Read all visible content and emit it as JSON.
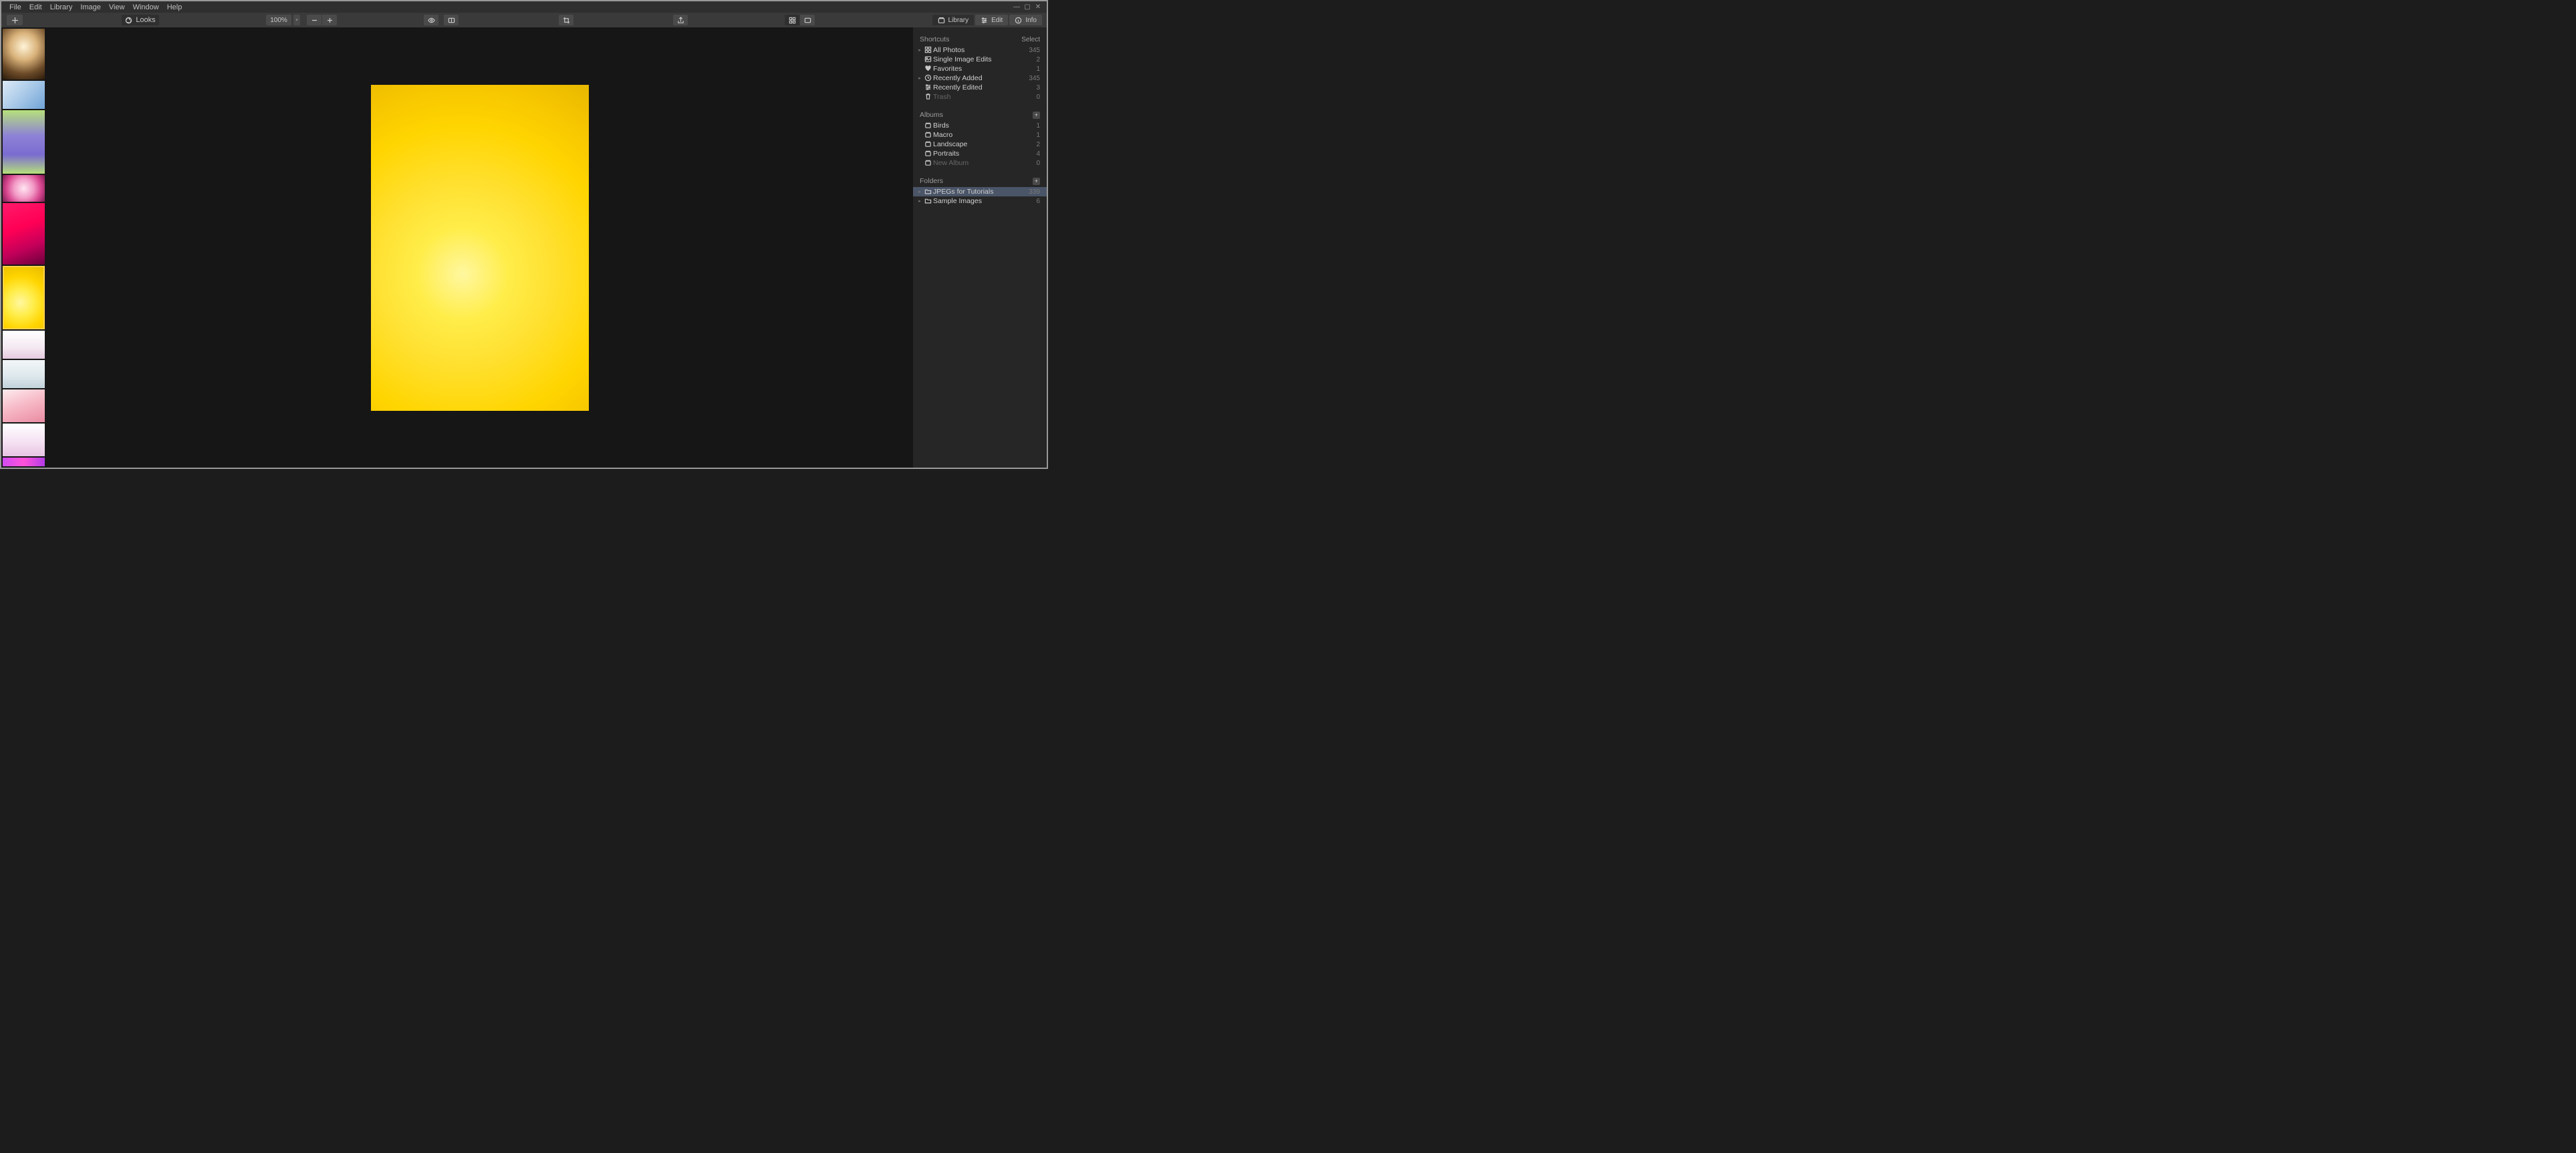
{
  "menu": {
    "items": [
      "File",
      "Edit",
      "Library",
      "Image",
      "View",
      "Window",
      "Help"
    ]
  },
  "toolbar": {
    "looks_label": "Looks",
    "zoom_label": "100%",
    "modes": {
      "library": "Library",
      "edit": "Edit",
      "info": "Info"
    }
  },
  "filmstrip": {
    "selected_index": 5,
    "thumbs": [
      {
        "h": 76,
        "grad": "radial-gradient(circle at 50% 35%, #fff4d8 0%, #d9b27a 35%, #6b4a28 70%, #2a1a0a 100%)"
      },
      {
        "h": 42,
        "grad": "linear-gradient(135deg,#dceaf6 0%, #a9c9e8 50%, #6fa3d6 100%)"
      },
      {
        "h": 95,
        "grad": "linear-gradient(180deg,#b6e07a 0%, #8d82d6 40%, #7a6cd0 70%, #b6e07a 100%)"
      },
      {
        "h": 40,
        "grad": "radial-gradient(circle at 50% 50%, #ffe6f2 0%, #f29ac6 40%, #d6458e 70%, #7a1d50 100%)"
      },
      {
        "h": 92,
        "grad": "linear-gradient(160deg,#ff1a6a 0%, #ff0055 40%, #c4005a 70%, #6a003a 100%)"
      },
      {
        "h": 95,
        "grad": "radial-gradient(circle at 42% 58%, #fff7a0 0%, #ffed4a 30%, #ffd500 60%, #e6b800 100%)"
      },
      {
        "h": 42,
        "grad": "linear-gradient(180deg,#ffffff 0%, #f4e9f1 60%, #e6c9de 100%)"
      },
      {
        "h": 42,
        "grad": "linear-gradient(180deg,#f2f6f8 0%, #dfe9ee 55%, #c2d3db 100%)"
      },
      {
        "h": 49,
        "grad": "linear-gradient(160deg,#fdebef 0%, #f6b7c4 50%, #e98ba2 100%)"
      },
      {
        "h": 49,
        "grad": "linear-gradient(180deg,#ffffff 0%, #f4dff1 60%, #e6c4e3 100%)"
      },
      {
        "h": 13,
        "grad": "linear-gradient(90deg,#d04df0 0%, #ff52d9 50%, #b23ce6 100%)"
      }
    ]
  },
  "canvas": {
    "grad": "radial-gradient(circle at 42% 58%, #fff7a0 0%, #ffed4a 20%, #ffe030 40%, #ffd500 65%, #f5c400 85%, #e6b800 100%)"
  },
  "rpanel": {
    "shortcuts_label": "Shortcuts",
    "select_label": "Select",
    "albums_label": "Albums",
    "folders_label": "Folders",
    "shortcuts": [
      {
        "icon": "grid",
        "label": "All Photos",
        "count": "345",
        "expandable": true
      },
      {
        "icon": "image",
        "label": "Single Image Edits",
        "count": "2"
      },
      {
        "icon": "heart",
        "label": "Favorites",
        "count": "1"
      },
      {
        "icon": "clock",
        "label": "Recently Added",
        "count": "345",
        "expandable": true
      },
      {
        "icon": "sliders",
        "label": "Recently Edited",
        "count": "3"
      },
      {
        "icon": "trash",
        "label": "Trash",
        "count": "0",
        "dim": true
      }
    ],
    "albums": [
      {
        "label": "Birds",
        "count": "1"
      },
      {
        "label": "Macro",
        "count": "1"
      },
      {
        "label": "Landscape",
        "count": "2"
      },
      {
        "label": "Portraits",
        "count": "4"
      },
      {
        "label": "New Album",
        "count": "0",
        "dim": true
      }
    ],
    "folders": [
      {
        "label": "JPEGs for Tutorials",
        "count": "339",
        "selected": true
      },
      {
        "label": "Sample Images",
        "count": "6"
      }
    ]
  }
}
